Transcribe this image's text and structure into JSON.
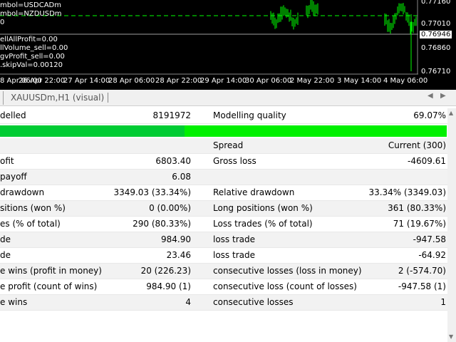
{
  "chart": {
    "indicator_lines": [
      "mbol=USDCADm",
      "mbol=NZDUSDm",
      "0",
      "ellAllProfit=0.00",
      "llVolume_sell=0.00",
      "gvProfit_sell=0.00",
      ".skipVal=0.00120"
    ],
    "price_labels": [
      "0.77160",
      "0.77010",
      "0.76946",
      "0.76860",
      "0.76710"
    ],
    "current_price": "0.76946",
    "time_labels": [
      "8 Apr 06:00",
      "26 Apr 22:00",
      "27 Apr 14:00",
      "28 Apr 06:00",
      "28 Apr 22:00",
      "29 Apr 14:00",
      "30 Apr 06:00",
      "2 May 22:00",
      "3 May 14:00",
      "4 May 06:00"
    ],
    "colors": {
      "background": "#000000",
      "candles": "#00ff00",
      "dashed_level": "#00ff00",
      "text": "#ffffff"
    }
  },
  "tabs": {
    "active": "XAUUSDm,H1 (visual)",
    "scroll_left_icon": "triangle-left-icon",
    "scroll_right_icon": "triangle-right-icon"
  },
  "report": {
    "modelled": {
      "label": "delled",
      "value": "8191972",
      "quality_label": "Modelling quality",
      "quality_value": "69.07%"
    },
    "quality_fraction": 0.4126,
    "colors": {
      "bar_fill": "#00cc33",
      "bar_track": "#00f000"
    },
    "rows": [
      {
        "l1": "",
        "v1": "",
        "l2": "Spread",
        "v2": "Current (300)"
      },
      {
        "l1": "ofit",
        "v1": "6803.40",
        "l2": "Gross loss",
        "v2": "-4609.61"
      },
      {
        "l1": "payoff",
        "v1": "6.08",
        "l2": "",
        "v2": ""
      },
      {
        "l1": "drawdown",
        "v1": "3349.03 (33.34%)",
        "l2": "Relative drawdown",
        "v2": "33.34% (3349.03)"
      },
      {
        "l1": "sitions (won %)",
        "v1": "0 (0.00%)",
        "l2": "Long positions (won %)",
        "v2": "361 (80.33%)"
      },
      {
        "l1": "es (% of total)",
        "v1": "290 (80.33%)",
        "l2": "Loss trades (% of total)",
        "v2": "71 (19.67%)"
      },
      {
        "l1": "de",
        "v1": "984.90",
        "l2": "loss trade",
        "v2": "-947.58"
      },
      {
        "l1": "de",
        "v1": "23.46",
        "l2": "loss trade",
        "v2": "-64.92"
      },
      {
        "l1": "e wins (profit in money)",
        "v1": "20 (226.23)",
        "l2": "consecutive losses (loss in money)",
        "v2": "2 (-574.70)"
      },
      {
        "l1": "e profit (count of wins)",
        "v1": "984.90 (1)",
        "l2": "consecutive loss (count of losses)",
        "v2": "-947.58 (1)"
      },
      {
        "l1": "e wins",
        "v1": "4",
        "l2": "consecutive losses",
        "v2": "1"
      }
    ]
  }
}
